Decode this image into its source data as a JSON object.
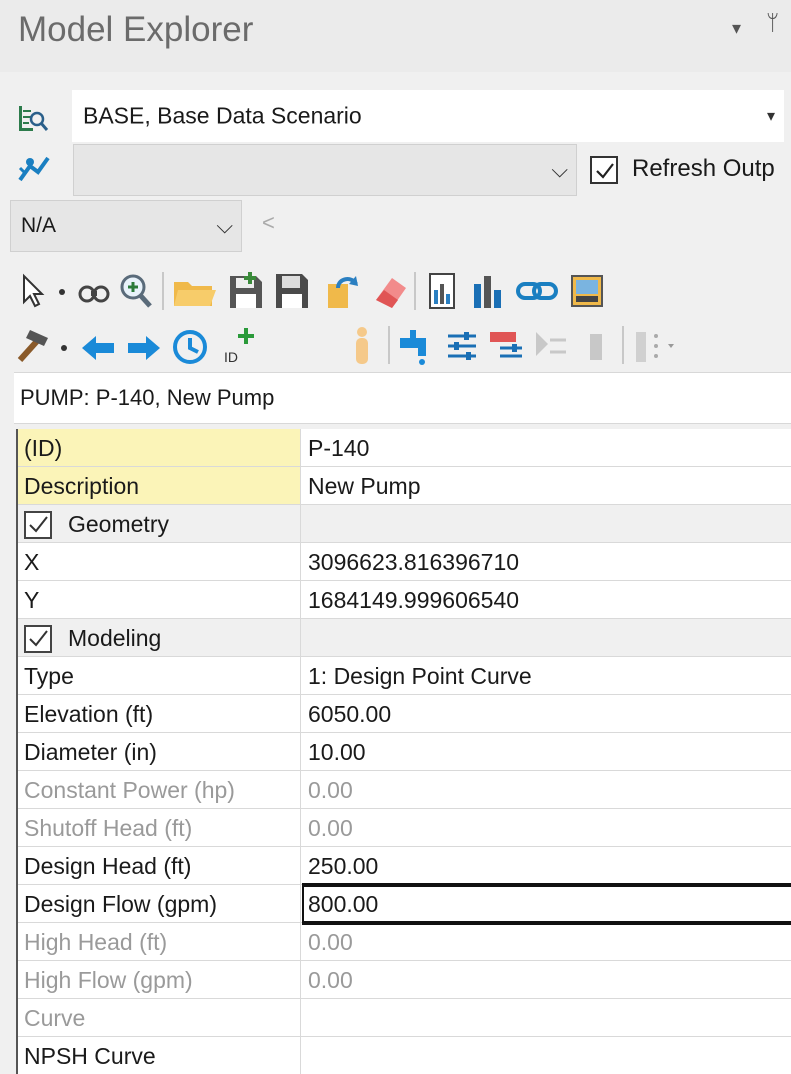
{
  "window": {
    "title": "Model Explorer",
    "menu_glyph": "▾",
    "pin_glyph": "ᛘ"
  },
  "scenario": {
    "value": "BASE, Base Data Scenario",
    "arrow": "▾"
  },
  "alternative": {
    "value": "",
    "arrow": "⌵",
    "refresh_label": "Refresh Outp"
  },
  "timestep": {
    "value": "N/A",
    "arrow": "⌵",
    "back": "<"
  },
  "toolbar_icons": [
    "select-pointer-icon",
    "binoculars-icon",
    "zoom-icon",
    "open-folder-icon",
    "save-icon",
    "save-as-icon",
    "undo-icon",
    "eraser-icon",
    "report-icon",
    "bar-chart-icon",
    "link-icon",
    "image-icon",
    "hammer-icon",
    "arrow-left-icon",
    "arrow-right-icon",
    "history-icon",
    "add-id-icon",
    "person-icon",
    "faucet-icon",
    "settings-sliders-icon",
    "valve-settings-icon",
    "filter-icon",
    "trash-icon",
    "more-icon"
  ],
  "element_header": "PUMP: P-140, New Pump",
  "properties": [
    {
      "type": "field",
      "label": "(ID)",
      "value": "P-140",
      "highlight": true
    },
    {
      "type": "field",
      "label": "Description",
      "value": "New Pump",
      "highlight": true
    },
    {
      "type": "category",
      "label": "Geometry"
    },
    {
      "type": "field",
      "label": "X",
      "value": "3096623.816396710"
    },
    {
      "type": "field",
      "label": "Y",
      "value": "1684149.999606540"
    },
    {
      "type": "category",
      "label": "Modeling"
    },
    {
      "type": "field",
      "label": "Type",
      "value": "1: Design Point Curve"
    },
    {
      "type": "field",
      "label": "Elevation (ft)",
      "value": "6050.00"
    },
    {
      "type": "field",
      "label": "Diameter (in)",
      "value": "10.00"
    },
    {
      "type": "field",
      "label": "Constant Power (hp)",
      "value": "0.00",
      "disabled": true
    },
    {
      "type": "field",
      "label": "Shutoff Head (ft)",
      "value": "0.00",
      "disabled": true
    },
    {
      "type": "field",
      "label": "Design Head (ft)",
      "value": "250.00"
    },
    {
      "type": "field",
      "label": "Design Flow (gpm)",
      "value": "800.00",
      "editing": true
    },
    {
      "type": "field",
      "label": "High Head (ft)",
      "value": "0.00",
      "disabled": true
    },
    {
      "type": "field",
      "label": "High Flow (gpm)",
      "value": "0.00",
      "disabled": true
    },
    {
      "type": "field",
      "label": "Curve",
      "value": "",
      "disabled": true
    },
    {
      "type": "field",
      "label": "NPSH Curve",
      "value": ""
    }
  ]
}
